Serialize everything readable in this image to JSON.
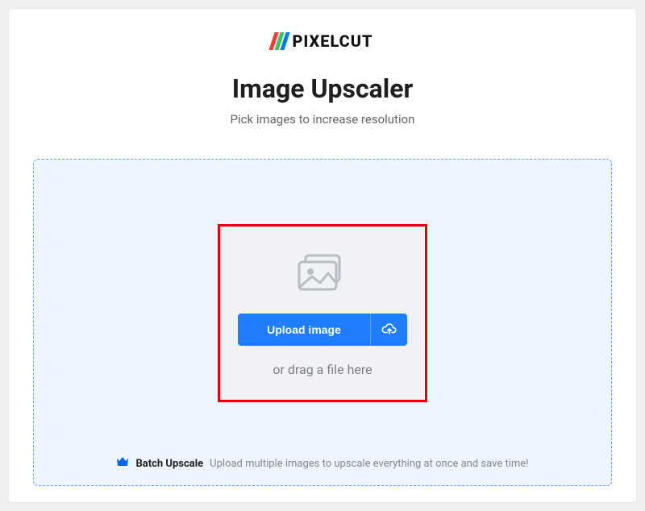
{
  "brand": {
    "name": "PIXELCUT"
  },
  "header": {
    "title": "Image Upscaler",
    "subtitle": "Pick images to increase resolution"
  },
  "upload": {
    "button_label": "Upload image",
    "drag_text": "or drag a file here"
  },
  "batch": {
    "label": "Batch Upscale",
    "description": "Upload multiple images to upscale everything at once and save time!"
  }
}
